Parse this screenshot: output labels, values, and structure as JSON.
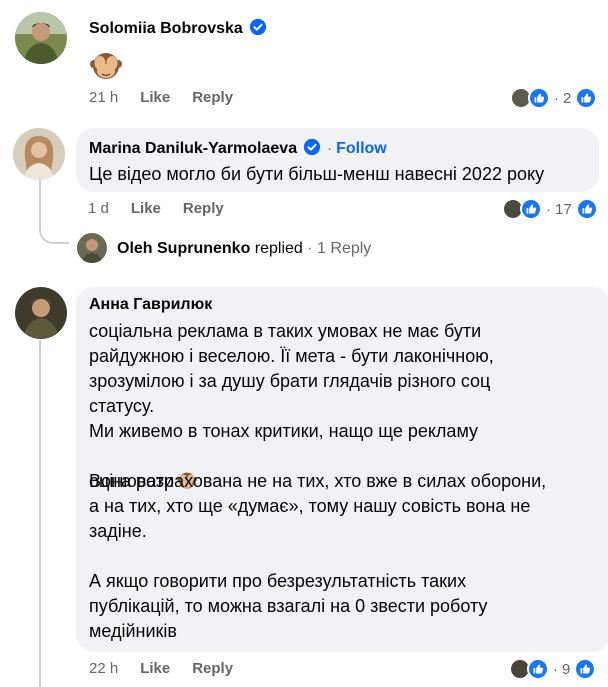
{
  "comments": [
    {
      "author": "Solomiia Bobrovska",
      "time": "21 h",
      "like": "Like",
      "reply": "Reply",
      "reactions": "2"
    },
    {
      "author": "Marina Daniluk-Yarmolaeva",
      "follow": "Follow",
      "text": "Це відео могло би бути більш-менш навесні 2022 року",
      "time": "1 d",
      "like": "Like",
      "reply": "Reply",
      "reactions": "17"
    },
    {
      "author": "Анна Гаврилюк",
      "text1": "соціальна реклама в таких умовах не має бути\nрайдужною і веселою. Її мета - бути лаконічною,\nзрозумілою і за душу брати глядачів різного соц\nстатусу.\nМи живемо в тонах критики, нащо ще рекламу",
      "text2": "оцінювати",
      "text3": "Вона розрахована не на тих, хто вже в силах оборони,\nа на тих, хто ще «думає», тому нашу совість вона не\nзадіне.\n\nА якщо говорити про безрезультатність таких\nпублікацій, то можна взагалі на 0 звести роботу\nмедійників",
      "time": "22 h",
      "like": "Like",
      "reply": "Reply",
      "reactions": "9"
    }
  ],
  "reply_summary": {
    "author": "Oleh Suprunenko",
    "action": "replied",
    "count": "1 Reply"
  },
  "colors": {
    "link": "#0866ff",
    "secondary_text": "#65676b",
    "bubble": "#f0f2f5",
    "like_blue": "#1877f2"
  },
  "icons": [
    "verified-badge-icon",
    "see-no-evil-monkey-emoji",
    "like-reaction-icon",
    "avatar-reaction-icon"
  ]
}
